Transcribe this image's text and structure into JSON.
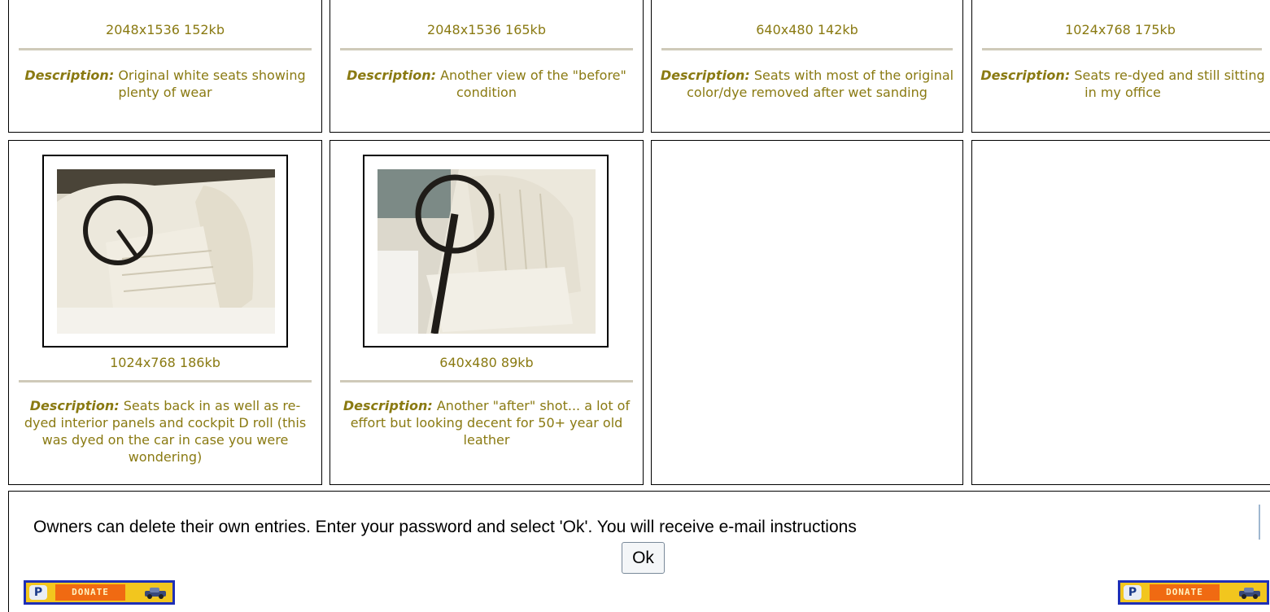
{
  "top_row": [
    {
      "size": "2048x1536 152kb",
      "label": "Description:",
      "text": "Original white seats showing plenty of wear"
    },
    {
      "size": "2048x1536 165kb",
      "label": "Description:",
      "text": "Another view of the \"before\" condition"
    },
    {
      "size": "640x480 142kb",
      "label": "Description:",
      "text": "Seats with most of the original color/dye removed after wet sanding"
    },
    {
      "size": "1024x768 175kb",
      "label": "Description:",
      "text": "Seats re-dyed and still sitting in my office"
    }
  ],
  "bottom_row": [
    {
      "size": "1024x768 186kb",
      "label": "Description:",
      "text": "Seats back in as well as re-dyed interior panels and cockpit D roll (this was dyed on the car in case you were wondering)"
    },
    {
      "size": "640x480 89kb",
      "label": "Description:",
      "text": "Another \"after\" shot... a lot of effort but looking decent for 50+ year old leather"
    }
  ],
  "footer": {
    "notice": "Owners can delete their own entries. Enter your password and select 'Ok'. You will receive e-mail instructions",
    "ok_label": "Ok",
    "donate_label": "DONATE"
  },
  "colors": {
    "text_olive": "#8a7a12",
    "rule": "#cfcab9",
    "donate_border": "#1e2fb6"
  }
}
